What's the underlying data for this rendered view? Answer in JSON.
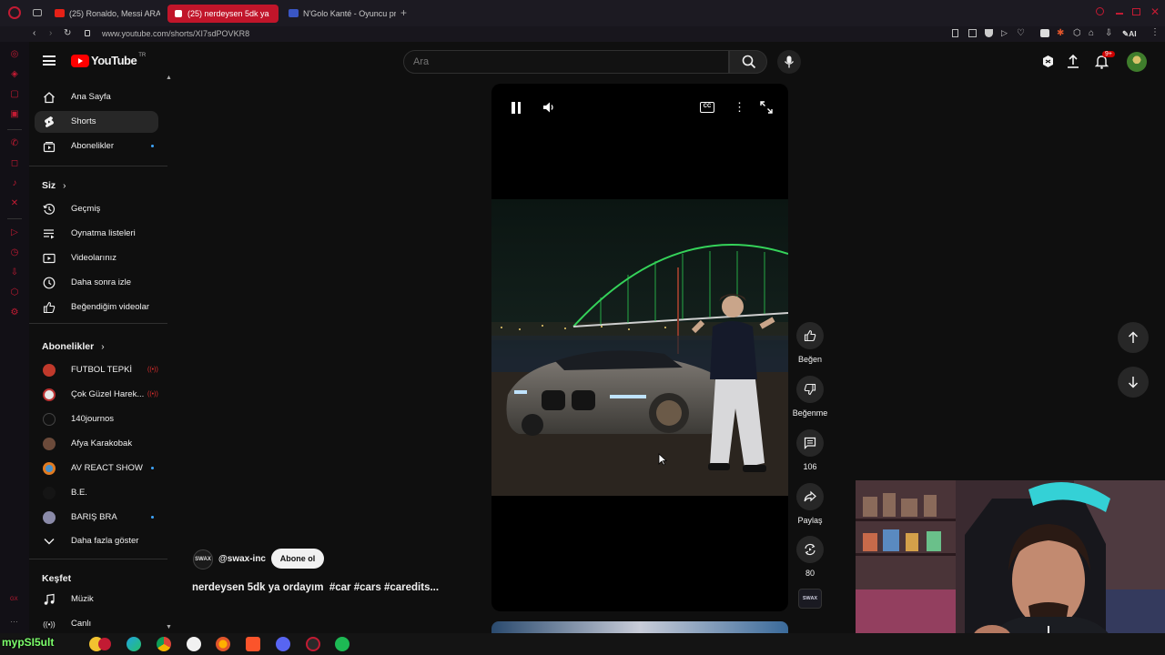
{
  "browser": {
    "tabs": [
      {
        "label": "(25) Ronaldo, Messi ARAB",
        "active": false
      },
      {
        "label": "(25) nerdeysen 5dk ya",
        "active": true
      },
      {
        "label": "N'Golo Kanté - Oyuncu pr",
        "active": false
      }
    ],
    "url": "www.youtube.com/shorts/XI7sdPOVKR8",
    "ai_label": "AI"
  },
  "youtube": {
    "logo_text": "YouTube",
    "region": "TR",
    "search_placeholder": "Ara",
    "notifications_badge": "9+",
    "sidebar": {
      "main": [
        {
          "label": "Ana Sayfa",
          "icon": "home-icon"
        },
        {
          "label": "Shorts",
          "icon": "shorts-icon",
          "active": true
        },
        {
          "label": "Abonelikler",
          "icon": "subscriptions-icon",
          "dot": true
        }
      ],
      "you_title": "Siz",
      "you": [
        {
          "label": "Geçmiş",
          "icon": "history-icon"
        },
        {
          "label": "Oynatma listeleri",
          "icon": "playlists-icon"
        },
        {
          "label": "Videolarınız",
          "icon": "your-videos-icon"
        },
        {
          "label": "Daha sonra izle",
          "icon": "watch-later-icon"
        },
        {
          "label": "Beğendiğim videolar",
          "icon": "liked-icon"
        }
      ],
      "subs_title": "Abonelikler",
      "subs": [
        {
          "label": "FUTBOL TEPKİ",
          "live": true,
          "color": "#c0392b"
        },
        {
          "label": "Çok Güzel Harek...",
          "live": true,
          "color": "#e8e8e8"
        },
        {
          "label": "140journos",
          "color": "#111111"
        },
        {
          "label": "Afya Karakobak",
          "color": "#6b4a3a"
        },
        {
          "label": "AV REACT SHOW",
          "dot": true,
          "color": "#e07a20"
        },
        {
          "label": "B.E.",
          "color": "#151515"
        },
        {
          "label": "BARIŞ BRA",
          "dot": true,
          "color": "#8a8aa8"
        },
        {
          "label": "Daha fazla göster",
          "icon": "chevron-down-icon"
        }
      ],
      "explore_title": "Keşfet",
      "explore": [
        {
          "label": "Müzik",
          "icon": "music-icon"
        },
        {
          "label": "Canlı",
          "icon": "live-icon"
        }
      ]
    },
    "short": {
      "channel": "@swax-inc",
      "subscribe_label": "Abone ol",
      "title": "nerdeysen 5dk ya ordayım  #car #cars #caredits...",
      "like_label": "Beğen",
      "dislike_label": "Beğenme",
      "comments_count": "106",
      "share_label": "Paylaş",
      "remix_count": "80"
    }
  },
  "taskbar": {
    "user_label": "mypSI5ult"
  }
}
